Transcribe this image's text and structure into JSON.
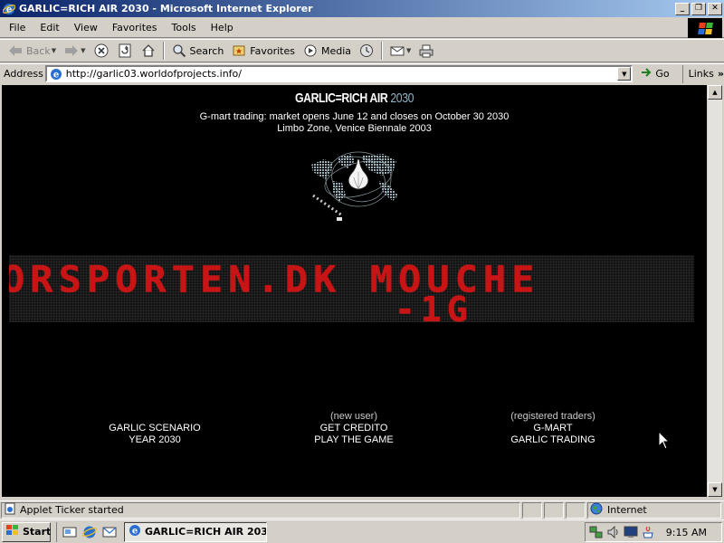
{
  "window": {
    "title": "GARLIC=RICH AIR 2030 - Microsoft Internet Explorer",
    "controls": {
      "minimize": "_",
      "maximize": "❐",
      "close": "✕"
    }
  },
  "menubar": {
    "items": [
      "File",
      "Edit",
      "View",
      "Favorites",
      "Tools",
      "Help"
    ]
  },
  "toolbar": {
    "back_label": "Back",
    "forward_label": "",
    "search_label": "Search",
    "favorites_label": "Favorites",
    "media_label": "Media"
  },
  "address": {
    "label": "Address",
    "url": "http://garlic03.worldofprojects.info/",
    "go_label": "Go",
    "links_label": "Links",
    "links_chevron": "»"
  },
  "page": {
    "title_main": "GARLIC=RICH AIR ",
    "title_year": "2030",
    "subtitle": "G-mart trading: market opens June 12 and closes on October 30 2030",
    "location": "Limbo Zone, Venice Biennale 2003",
    "ticker_line1": "ORSPORTEN.DK   MOUCHE",
    "ticker_line2": "-1G",
    "colors": {
      "background": "#000000",
      "ticker_red": "#c81414",
      "title_year": "#8fb0c0"
    },
    "columns": [
      {
        "note": "",
        "line1": "GARLIC SCENARIO",
        "line2": "YEAR 2030"
      },
      {
        "note": "(new user)",
        "line1": "GET CREDITO",
        "line2": "PLAY THE GAME"
      },
      {
        "note": "(registered traders)",
        "line1": "G-MART",
        "line2": "GARLIC TRADING"
      }
    ]
  },
  "status": {
    "text": "Applet Ticker started",
    "zone": "Internet"
  },
  "taskbar": {
    "start_label": "Start",
    "task_label": "GARLIC=RICH AIR 203...",
    "clock": "9:15 AM"
  },
  "icons": {
    "browser": "ie-icon",
    "back": "back-arrow-icon",
    "forward": "forward-arrow-icon",
    "stop": "stop-icon",
    "refresh": "refresh-icon",
    "home": "home-icon",
    "search": "search-icon",
    "favorites": "favorites-icon",
    "media": "media-icon",
    "history": "history-icon",
    "mail": "mail-icon",
    "print": "print-icon"
  }
}
